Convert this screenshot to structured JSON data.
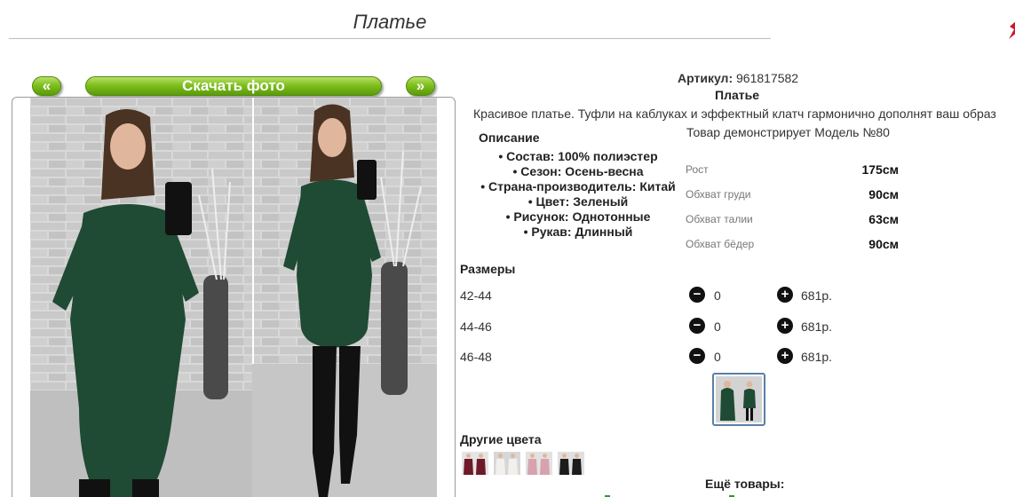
{
  "page": {
    "title": "Платье"
  },
  "nav": {
    "prev_label": "«",
    "download_label": "Скачать фото",
    "next_label": "»"
  },
  "product": {
    "article_label": "Артикул:",
    "article_value": "961817582",
    "name": "Платье",
    "description": "Красивое платье. Туфли на каблуках и эффектный клатч гармонично дополнят ваш образ"
  },
  "description_section": {
    "heading": "Описание",
    "properties": [
      "Состав: 100% полиэстер",
      "Сезон: Осень-весна",
      "Страна-производитель: Китай",
      "Цвет: Зеленый",
      "Рисунок: Однотонные",
      "Рукав: Длинный"
    ]
  },
  "model": {
    "title": "Товар демонстрирует Модель №80",
    "measurements": [
      {
        "label": "Рост",
        "value": "175см"
      },
      {
        "label": "Обхват груди",
        "value": "90см"
      },
      {
        "label": "Обхват талии",
        "value": "63см"
      },
      {
        "label": "Обхват бёдер",
        "value": "90см"
      }
    ]
  },
  "sizes": {
    "heading": "Размеры",
    "rows": [
      {
        "size": "42-44",
        "qty": "0",
        "price": "681р."
      },
      {
        "size": "44-46",
        "qty": "0",
        "price": "681р."
      },
      {
        "size": "46-48",
        "qty": "0",
        "price": "681р."
      }
    ],
    "minus_symbol": "−",
    "plus_symbol": "+"
  },
  "other_colors": {
    "heading": "Другие цвета",
    "swatches": [
      {
        "name": "burgundy",
        "color": "#6e1a2a"
      },
      {
        "name": "white",
        "color": "#e9e6e2"
      },
      {
        "name": "pink",
        "color": "#d7a2ad"
      },
      {
        "name": "black",
        "color": "#1c1c1c"
      }
    ]
  },
  "more_products": {
    "heading": "Ещё товары:"
  },
  "colors": {
    "accent_green": "#6fae16",
    "dress_green": "#1f4a33",
    "brick_wall": "#d2d2d2",
    "corner_mark": "#d0182a"
  }
}
